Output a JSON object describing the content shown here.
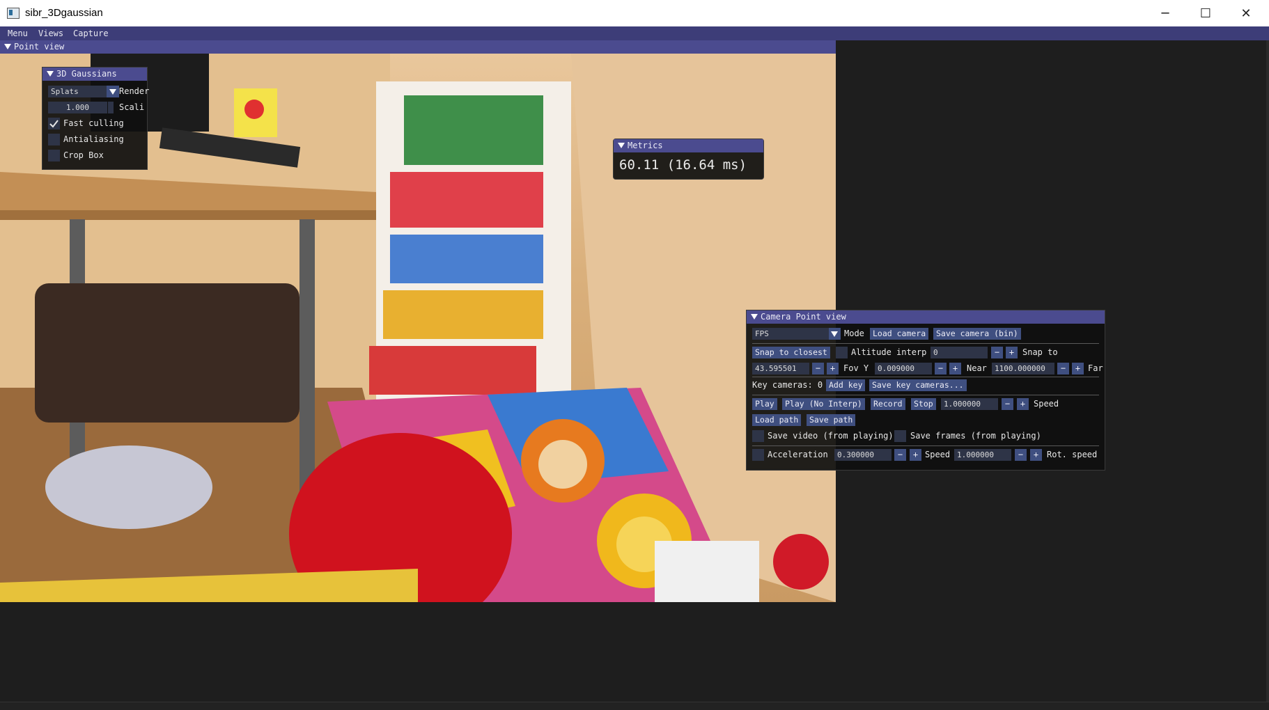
{
  "window": {
    "title": "sibr_3Dgaussian",
    "minimize_glyph": "─",
    "maximize_glyph": "☐",
    "close_glyph": "✕"
  },
  "menubar": [
    "Menu",
    "Views",
    "Capture"
  ],
  "point_view": {
    "title": "Point view"
  },
  "gaussians_panel": {
    "title": "3D Gaussians",
    "render_mode": "Splats",
    "render_label": "Render",
    "scaling_value": "1.000",
    "scaling_label": "Scali",
    "fast_culling_label": "Fast culling",
    "fast_culling_checked": true,
    "antialiasing_label": "Antialiasing",
    "antialiasing_checked": false,
    "crop_box_label": "Crop Box",
    "crop_box_checked": false
  },
  "metrics_panel": {
    "title": "Metrics",
    "fps_text": "60.11 (16.64 ms)"
  },
  "camera_panel": {
    "title": "Camera Point view",
    "mode_value": "FPS",
    "mode_label": "Mode",
    "load_camera": "Load camera",
    "save_camera_bin": "Save camera (bin)",
    "snap_to_closest": "Snap to closest",
    "altitude_interp_label": "Altitude interp",
    "altitude_interp_checked": false,
    "snap_value": "0",
    "snap_to_label": "Snap to",
    "fovy_value": "43.595501",
    "fovy_label": "Fov Y",
    "near_value": "0.009000",
    "near_label": "Near",
    "far_value": "1100.000000",
    "far_label": "Far",
    "key_cameras_label": "Key cameras: 0",
    "add_key": "Add key",
    "save_key_cameras": "Save key cameras...",
    "play": "Play",
    "play_no_interp": "Play (No Interp)",
    "record": "Record",
    "stop": "Stop",
    "speed_value": "1.000000",
    "speed_label": "Speed",
    "load_path": "Load path",
    "save_path": "Save path",
    "save_video_label": "Save video (from playing)",
    "save_frames_label": "Save frames (from playing)",
    "acceleration_label": "Acceleration",
    "acceleration_value": "0.300000",
    "speed2_label": "Speed",
    "speed2_value": "1.000000",
    "rot_speed_label": "Rot. speed",
    "minus": "−",
    "plus": "+"
  },
  "colors": {
    "titlebar_bg": "#ffffff",
    "menubar_bg": "#3d3d78",
    "window_title_bg": "#4b4b8f",
    "button_bg": "#3f4f80",
    "field_bg": "#2e3447",
    "app_bg": "#1e1e1e"
  }
}
